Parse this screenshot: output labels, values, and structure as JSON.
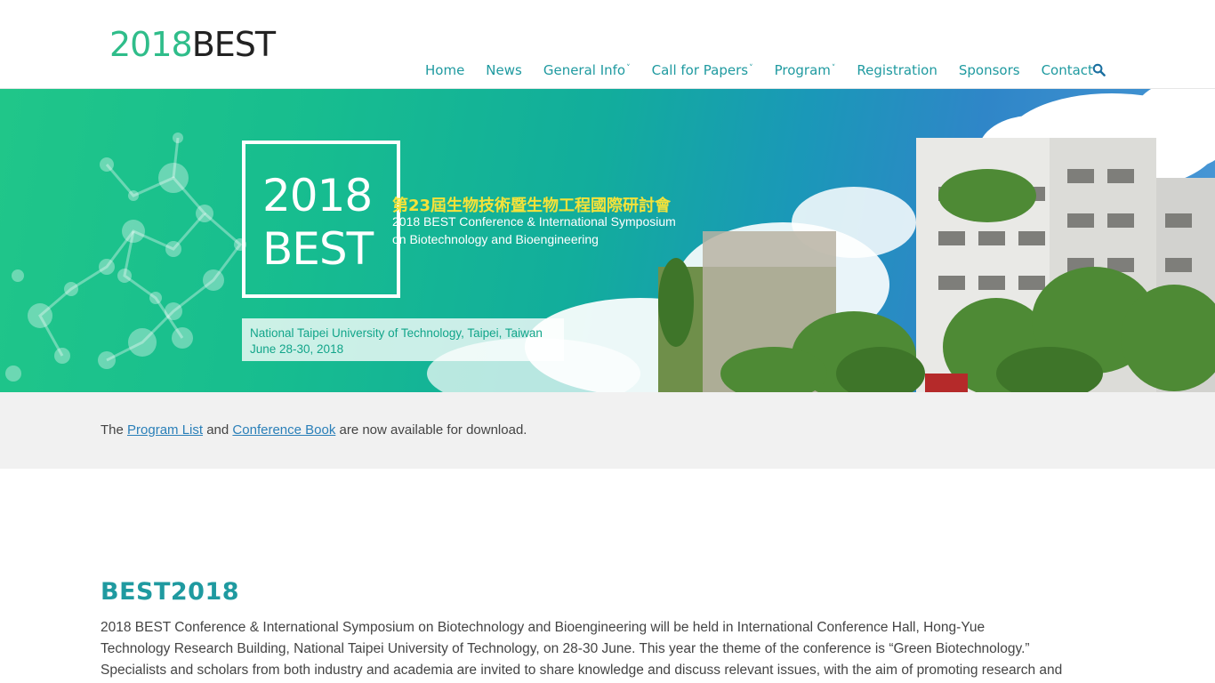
{
  "logo": {
    "year": "2018",
    "name": "BEST"
  },
  "nav": {
    "items": [
      {
        "label": "Home",
        "dropdown": false
      },
      {
        "label": "News",
        "dropdown": false
      },
      {
        "label": "General Info",
        "dropdown": true
      },
      {
        "label": "Call for Papers",
        "dropdown": true
      },
      {
        "label": "Program",
        "dropdown": true
      },
      {
        "label": "Registration",
        "dropdown": false
      },
      {
        "label": "Sponsors",
        "dropdown": false
      },
      {
        "label": "Contact",
        "dropdown": false
      }
    ],
    "search_icon": "search-icon",
    "chevron_glyph": "˅"
  },
  "banner": {
    "year": "2018",
    "best": "BEST",
    "chinese_title": "第23屆生物技術暨生物工程國際研討會",
    "english_title_line1": "2018 BEST Conference & International Symposium",
    "english_title_line2": "on Biotechnology and Bioengineering",
    "location_line1": "National Taipei University of Technology, Taipei, Taiwan",
    "location_line2": "June 28-30, 2018"
  },
  "notice": {
    "prefix": "The ",
    "link1": "Program List",
    "middle": " and ",
    "link2": "Conference Book",
    "suffix": " are now available for download."
  },
  "content": {
    "title": "BEST2018",
    "lines": [
      "2018 BEST Conference & International Symposium on Biotechnology and Bioengineering will be held in International Conference Hall, Hong-Yue",
      "Technology Research Building, National Taipei University of Technology, on 28-30 June. This year the theme of the conference is “Green Biotechnology.”",
      "Specialists and scholars from both industry and academia are invited to share knowledge and discuss relevant issues, with the aim of promoting research and"
    ]
  },
  "colors": {
    "accent": "#1f9aa0",
    "logo_green": "#2fbd8a",
    "link": "#2a7fb8",
    "banner_yellow": "#f4e23a"
  }
}
